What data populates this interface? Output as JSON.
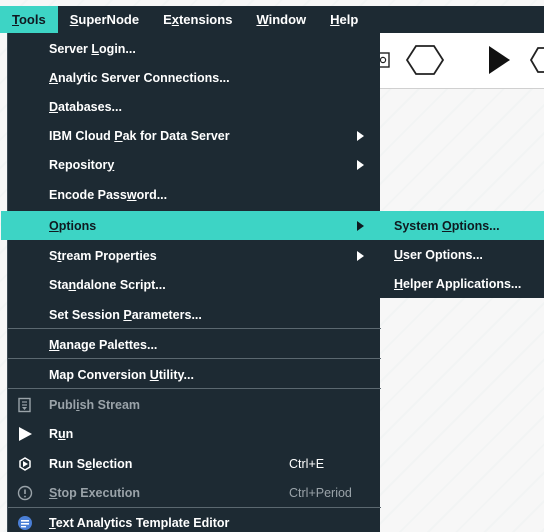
{
  "menubar": {
    "items": [
      {
        "label": "Tools",
        "key": "T",
        "rest": "ools"
      },
      {
        "label": "SuperNode",
        "key": "S",
        "rest": "uperNode"
      },
      {
        "label": "Extensions",
        "pre": "E",
        "key": "x",
        "rest": "tensions"
      },
      {
        "label": "Window",
        "key": "W",
        "rest": "indow"
      },
      {
        "label": "Help",
        "key": "H",
        "rest": "elp"
      }
    ]
  },
  "tools_menu": {
    "items": [
      {
        "pre": "Server ",
        "key": "L",
        "rest": "ogin..."
      },
      {
        "pre": "",
        "key": "A",
        "rest": "nalytic Server Connections..."
      },
      {
        "pre": "",
        "key": "D",
        "rest": "atabases..."
      },
      {
        "pre": "IBM Cloud ",
        "key": "P",
        "rest": "ak for Data Server"
      },
      {
        "pre": "Repositor",
        "key": "y",
        "rest": ""
      },
      {
        "pre": "Encode Pass",
        "key": "w",
        "rest": "ord..."
      },
      {
        "pre": "",
        "key": "O",
        "rest": "ptions"
      },
      {
        "pre": "S",
        "key": "t",
        "rest": "ream Properties"
      },
      {
        "pre": "Sta",
        "key": "n",
        "rest": "dalone Script..."
      },
      {
        "pre": "Set Session ",
        "key": "P",
        "rest": "arameters..."
      },
      {
        "pre": "",
        "key": "M",
        "rest": "anage Palettes..."
      },
      {
        "pre": "Map Conversion ",
        "key": "U",
        "rest": "tility..."
      },
      {
        "pre": "Publ",
        "key": "i",
        "rest": "sh Stream"
      },
      {
        "pre": "R",
        "key": "u",
        "rest": "n"
      },
      {
        "pre": "Run S",
        "key": "e",
        "rest": "lection",
        "shortcut": "Ctrl+E"
      },
      {
        "pre": "",
        "key": "S",
        "rest": "top Execution",
        "shortcut": "Ctrl+Period"
      },
      {
        "pre": "",
        "key": "T",
        "rest": "ext Analytics Template Editor"
      }
    ]
  },
  "options_submenu": {
    "items": [
      {
        "pre": "System ",
        "key": "O",
        "rest": "ptions..."
      },
      {
        "pre": "",
        "key": "U",
        "rest": "ser Options..."
      },
      {
        "pre": "",
        "key": "H",
        "rest": "elper Applications..."
      }
    ]
  },
  "colors": {
    "menu_bg": "#1d2a33",
    "highlight": "#3dd4c5",
    "disabled_text": "#9aa3a9"
  }
}
